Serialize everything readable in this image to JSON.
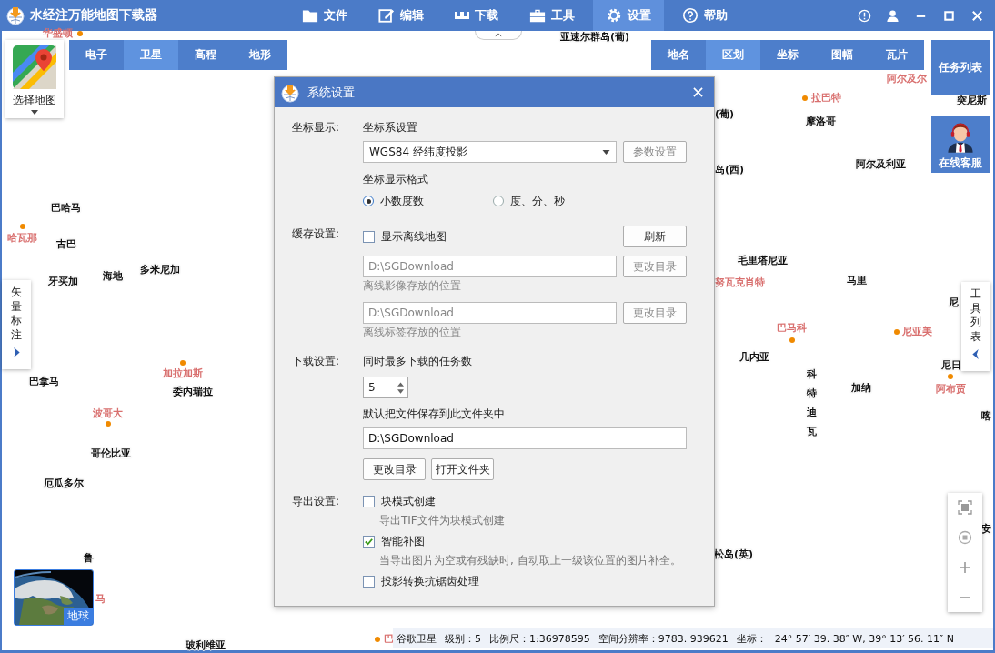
{
  "app": {
    "title": "水经注万能地图下载器"
  },
  "menu": [
    {
      "label": "文件",
      "selected": false
    },
    {
      "label": "编辑",
      "selected": false
    },
    {
      "label": "下载",
      "selected": false
    },
    {
      "label": "工具",
      "selected": false
    },
    {
      "label": "设置",
      "selected": true
    },
    {
      "label": "帮助",
      "selected": false
    }
  ],
  "map_types": [
    {
      "label": "电子",
      "selected": false
    },
    {
      "label": "卫星",
      "selected": true
    },
    {
      "label": "高程",
      "selected": false
    },
    {
      "label": "地形",
      "selected": false
    }
  ],
  "layers": [
    {
      "label": "地名",
      "selected": false
    },
    {
      "label": "区划",
      "selected": true
    },
    {
      "label": "坐标",
      "selected": false
    },
    {
      "label": "图幅",
      "selected": false
    },
    {
      "label": "瓦片",
      "selected": false
    }
  ],
  "map_selector": {
    "label": "选择地图"
  },
  "task_list_button": "任务列表",
  "support_button": "在线客服",
  "side_panels": {
    "left": "矢量标注",
    "right": "工具列表"
  },
  "globe_thumbnail": {
    "label": "地球"
  },
  "map_labels": [
    {
      "text": "华盛顿",
      "kind": "city"
    },
    {
      "text": "亚速尔群岛(葡)",
      "kind": "country"
    },
    {
      "text": "阿尔及尔",
      "kind": "city"
    },
    {
      "text": "拉巴特",
      "kind": "city"
    },
    {
      "text": "突尼斯",
      "kind": "country"
    },
    {
      "text": "(葡)",
      "kind": "country"
    },
    {
      "text": "摩洛哥",
      "kind": "country"
    },
    {
      "text": "岛(西)",
      "kind": "country"
    },
    {
      "text": "阿尔及利亚",
      "kind": "country"
    },
    {
      "text": "巴哈马",
      "kind": "country"
    },
    {
      "text": "哈瓦那",
      "kind": "city"
    },
    {
      "text": "古巴",
      "kind": "country"
    },
    {
      "text": "多米尼加",
      "kind": "country"
    },
    {
      "text": "海地",
      "kind": "country"
    },
    {
      "text": "牙买加",
      "kind": "country"
    },
    {
      "text": "毛里塔尼亚",
      "kind": "country"
    },
    {
      "text": "努瓦克肖特",
      "kind": "city"
    },
    {
      "text": "马里",
      "kind": "country"
    },
    {
      "text": "尼",
      "kind": "country"
    },
    {
      "text": "巴马科",
      "kind": "city"
    },
    {
      "text": "尼亚美",
      "kind": "city"
    },
    {
      "text": "几内亚",
      "kind": "country"
    },
    {
      "text": "加拉加斯",
      "kind": "city"
    },
    {
      "text": "巴拿马",
      "kind": "country"
    },
    {
      "text": "尼日",
      "kind": "country"
    },
    {
      "text": "委内瑞拉",
      "kind": "country"
    },
    {
      "text": "加纳",
      "kind": "country"
    },
    {
      "text": "阿布贾",
      "kind": "city"
    },
    {
      "text": "科特迪瓦",
      "kind": "vertical"
    },
    {
      "text": "波哥大",
      "kind": "city"
    },
    {
      "text": "喀",
      "kind": "country"
    },
    {
      "text": "哥伦比亚",
      "kind": "country"
    },
    {
      "text": "厄瓜多尔",
      "kind": "country"
    },
    {
      "text": "安",
      "kind": "country"
    },
    {
      "text": "松岛(英)",
      "kind": "country"
    },
    {
      "text": "鲁",
      "kind": "country"
    },
    {
      "text": "马",
      "kind": "city"
    },
    {
      "text": "玻利维亚",
      "kind": "country"
    },
    {
      "text": "巴",
      "kind": "city"
    }
  ],
  "dialog": {
    "title": "系统设置",
    "coords": {
      "label": "坐标显示:",
      "heading": "坐标系设置",
      "projection": "WGS84 经纬度投影",
      "params_button": {
        "label": "参数设置",
        "disabled": true
      },
      "format_heading": "坐标显示格式",
      "formats": [
        {
          "label": "小数度数",
          "selected": true
        },
        {
          "label": "度、分、秒",
          "selected": false
        }
      ]
    },
    "cache": {
      "label": "缓存设置:",
      "show_offline": {
        "label": "显示离线地图",
        "checked": false
      },
      "refresh_button": "刷新",
      "paths": [
        {
          "value": "D:\\SGDownload",
          "hint": "离线影像存放的位置",
          "button": "更改目录",
          "disabled": true
        },
        {
          "value": "D:\\SGDownload",
          "hint": "离线标签存放的位置",
          "button": "更改目录",
          "disabled": true
        }
      ]
    },
    "download": {
      "label": "下载设置:",
      "max_tasks_heading": "同时最多下载的任务数",
      "max_tasks": "5",
      "folder_heading": "默认把文件保存到此文件夹中",
      "folder": "D:\\SGDownload",
      "buttons": [
        "更改目录",
        "打开文件夹"
      ]
    },
    "export": {
      "label": "导出设置:",
      "options": [
        {
          "label": "块模式创建",
          "checked": false,
          "note": "导出TIF文件为块模式创建"
        },
        {
          "label": "智能补图",
          "checked": true,
          "note": "当导出图片为空或有残缺时, 自动取上一级该位置的图片补全。"
        },
        {
          "label": "投影转换抗锯齿处理",
          "checked": false
        }
      ]
    }
  },
  "status_bar": {
    "source": "谷歌卫星",
    "level": "级别：5",
    "scale": "比例尺：1:36978595",
    "resolution": "空间分辨率：9783. 939621",
    "coord_label": "坐标：",
    "coords": "24° 57′ 39. 38″ W, 39° 13′ 56. 11″ N"
  }
}
